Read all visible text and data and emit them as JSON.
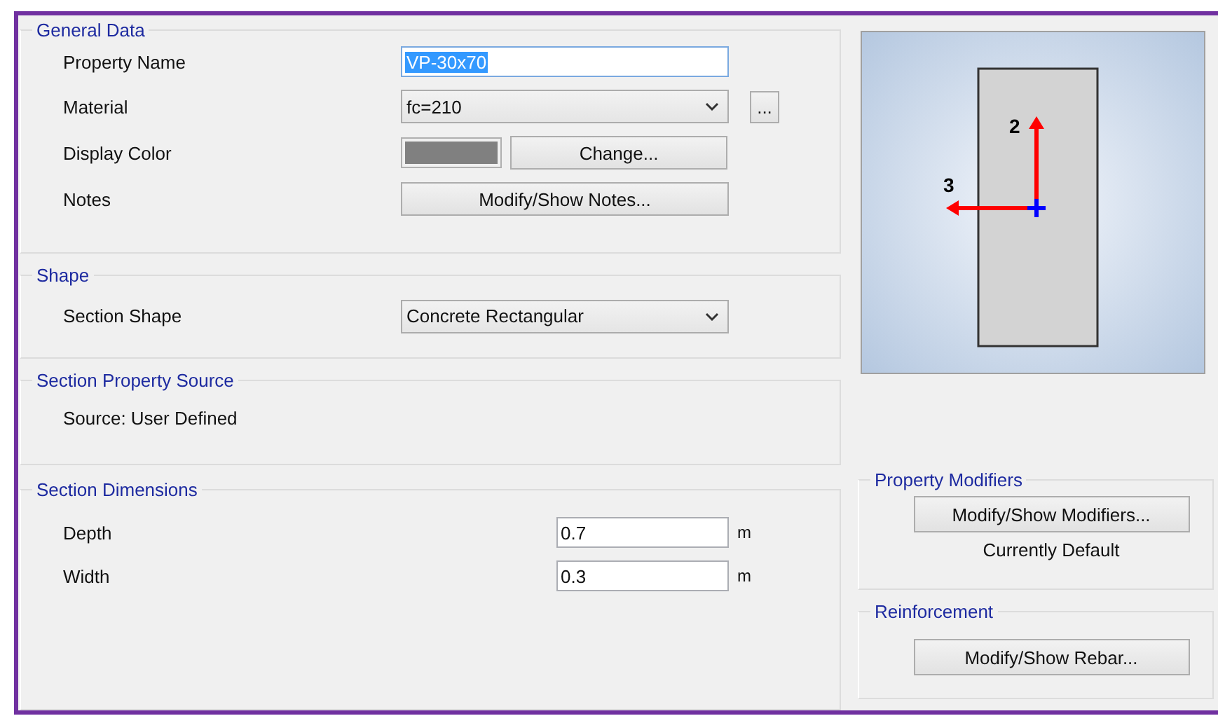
{
  "general_data": {
    "title": "General Data",
    "property_name": {
      "label": "Property Name",
      "value": "VP-30x70",
      "selected": true
    },
    "material": {
      "label": "Material",
      "value": "fc=210",
      "more_button": "..."
    },
    "display_color": {
      "label": "Display Color",
      "color": "#808080",
      "button": "Change..."
    },
    "notes": {
      "label": "Notes",
      "button": "Modify/Show Notes..."
    }
  },
  "shape": {
    "title": "Shape",
    "section_shape": {
      "label": "Section Shape",
      "value": "Concrete Rectangular"
    }
  },
  "section_property_source": {
    "title": "Section Property Source",
    "source": "Source:  User Defined"
  },
  "section_dimensions": {
    "title": "Section Dimensions",
    "fields": [
      {
        "label": "Depth",
        "value": "0.7",
        "unit": "m"
      },
      {
        "label": "Width",
        "value": "0.3",
        "unit": "m"
      }
    ]
  },
  "preview": {
    "axis_labels": [
      "2",
      "3"
    ]
  },
  "property_modifiers": {
    "title": "Property Modifiers",
    "button": "Modify/Show Modifiers...",
    "status": "Currently Default"
  },
  "reinforcement": {
    "title": "Reinforcement",
    "button": "Modify/Show Rebar..."
  }
}
